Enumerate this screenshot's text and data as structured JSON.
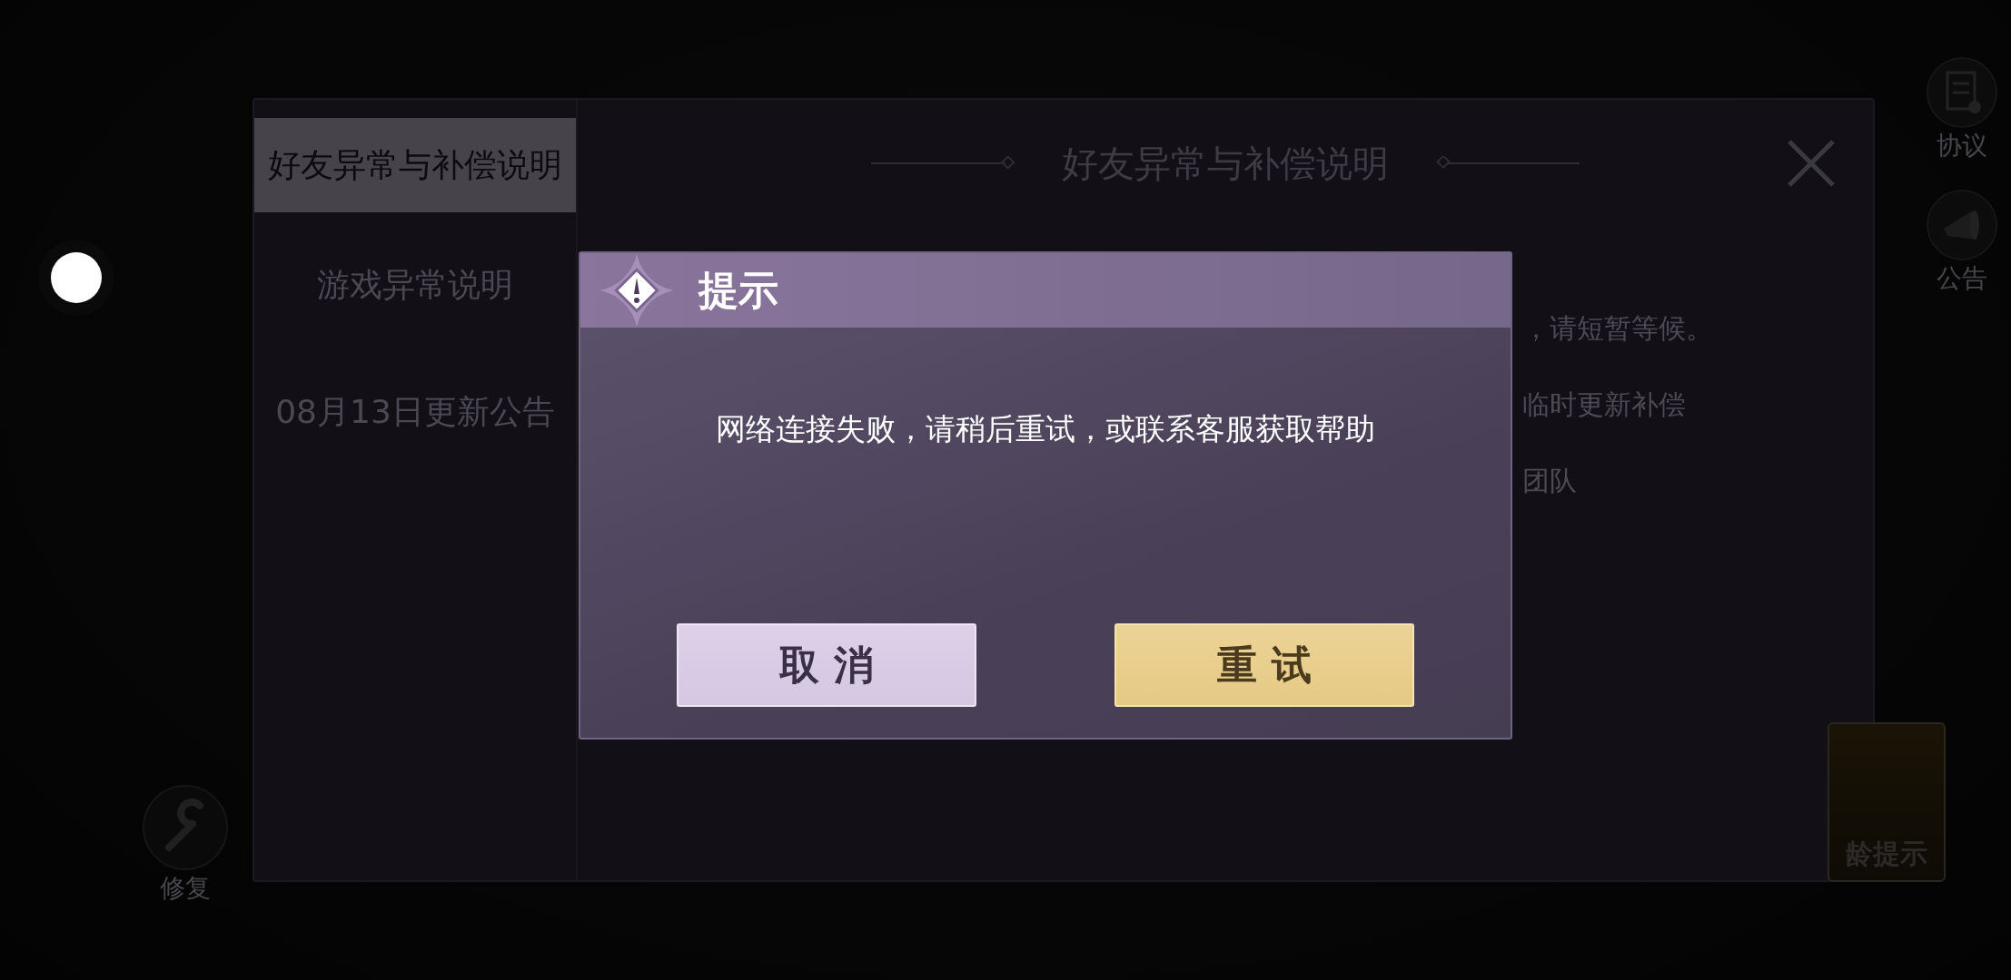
{
  "side_buttons": [
    {
      "kind": "document",
      "label": "协议"
    },
    {
      "kind": "megaphone",
      "label": "公告"
    }
  ],
  "repair_button": {
    "label": "修复"
  },
  "age_badge": {
    "label": "龄提示"
  },
  "panel": {
    "title": "好友异常与补偿说明",
    "tabs": [
      {
        "label": "好友异常与补偿说明",
        "selected": true
      },
      {
        "label": "游戏异常说明",
        "selected": false
      },
      {
        "label": "08月13日更新公告",
        "selected": false
      }
    ],
    "content_lines": [
      "，请短暂等候。",
      "临时更新补偿",
      "团队"
    ]
  },
  "dialog": {
    "title": "提示",
    "message": "网络连接失败，请稍后重试，或联系客服获取帮助",
    "buttons": [
      {
        "kind": "secondary",
        "label": "取 消"
      },
      {
        "kind": "primary",
        "label": "重 试"
      }
    ]
  }
}
